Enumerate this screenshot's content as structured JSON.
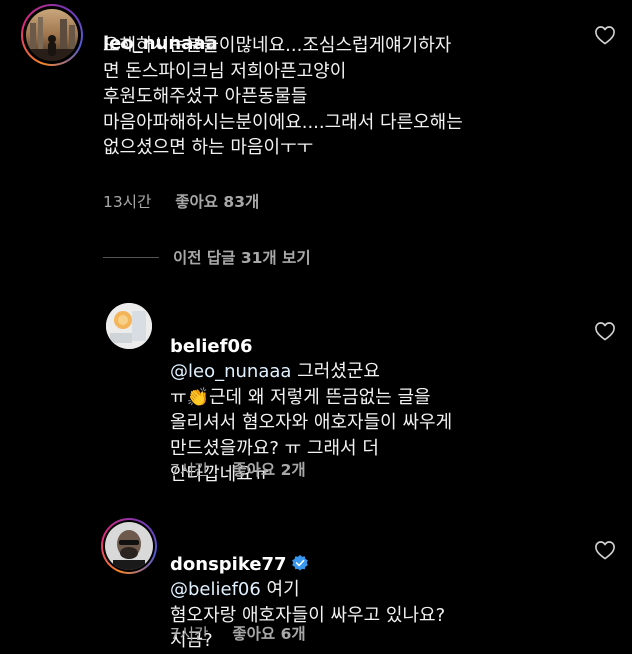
{
  "comments": [
    {
      "username": "leo_nunaaa",
      "text": "오해하시는분들이많네요...조심스럽게얘기하자\n면  돈스파이크님 저희아픈고양이\n후원도해주셨구 아픈동물들\n마음아파해하시는분이에요....그래서 다른오해는\n없으셨으면 하는 마음이ㅜㅜ",
      "time": "13시간",
      "likes": "좋아요 83개",
      "verified": false
    }
  ],
  "view_replies": "이전 답글 31개 보기",
  "replies": [
    {
      "username": "belief06",
      "mention": "@leo_nunaaa",
      "text": " 그러셨군요\nㅠ👏근데 왜  저렇게 뜬금없는 글을\n올리셔서 혐오자와 애호자들이 싸우게\n만드셨을까요? ㅠ  그래서 더\n안타깝네요ㅠ",
      "time": "7시간",
      "likes": "좋아요 2개",
      "verified": false
    },
    {
      "username": "donspike77",
      "mention": "@belief06",
      "text": " 여기\n혐오자랑 애호자들이 싸우고 있나요?\n지금?",
      "time": "7시간",
      "likes": "좋아요 6개",
      "verified": true
    }
  ],
  "icons": {
    "like": "heart-outline-icon",
    "verified": "verified-badge-icon"
  },
  "colors": {
    "background": "#000000",
    "text": "#f2f2f2",
    "meta": "#a8a8a8",
    "verified": "#3897f0"
  }
}
